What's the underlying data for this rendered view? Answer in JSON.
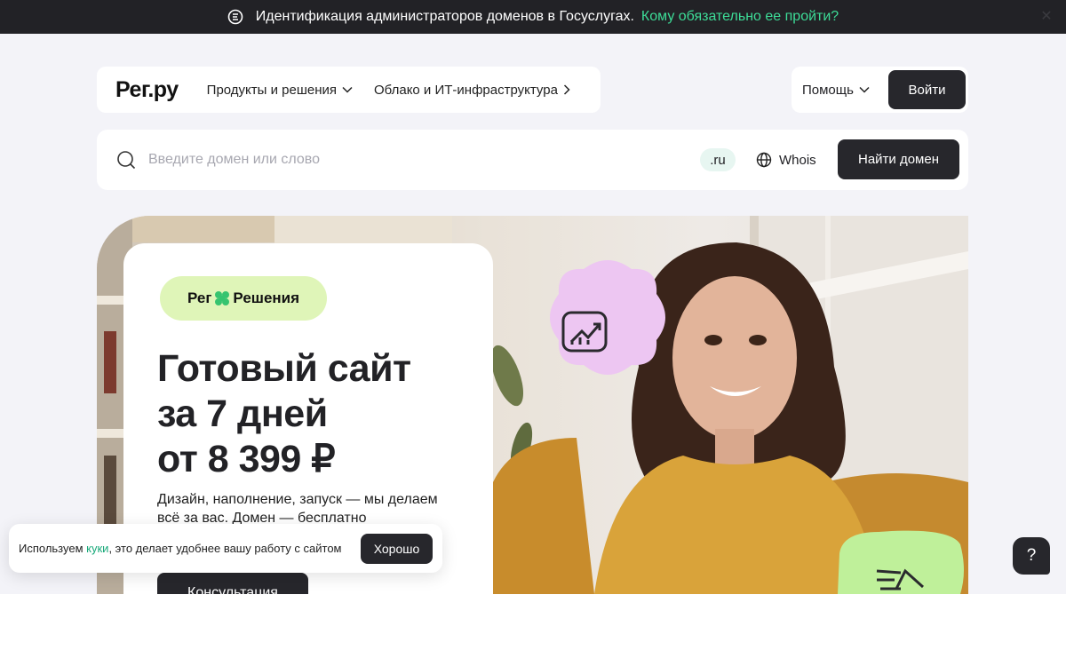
{
  "announcement": {
    "text": "Идентификация администраторов доменов в Госуслугах.",
    "link": "Кому обязательно ее пройти?"
  },
  "nav": {
    "logo": "Рег.ру",
    "products": "Продукты и решения",
    "cloud": "Облако и ИТ-инфраструктура",
    "help": "Помощь",
    "login": "Войти"
  },
  "search": {
    "placeholder": "Введите домен или слово",
    "zone": ".ru",
    "whois": "Whois",
    "button": "Найти домен"
  },
  "hero": {
    "badge_left": "Рег",
    "badge_right": "Решения",
    "headline_line1": "Готовый сайт",
    "headline_line2": "за 7 дней",
    "headline_line3": "от 8 399 ₽",
    "subtitle_line1": "Дизайн, наполнение, запуск — мы делаем",
    "subtitle_line2": "всё за вас. Домен — бесплатно",
    "cta": "Консультация"
  },
  "cookie": {
    "prefix": "Используем",
    "link": "куки",
    "suffix": ", это делает удобнее вашу работу с сайтом",
    "button": "Хорошо"
  },
  "help_fab": "?",
  "colors": {
    "dark": "#27272c",
    "accent_green": "#3ddc97",
    "badge_bg": "#dff5b8",
    "page_bg": "#f3f3f8"
  }
}
